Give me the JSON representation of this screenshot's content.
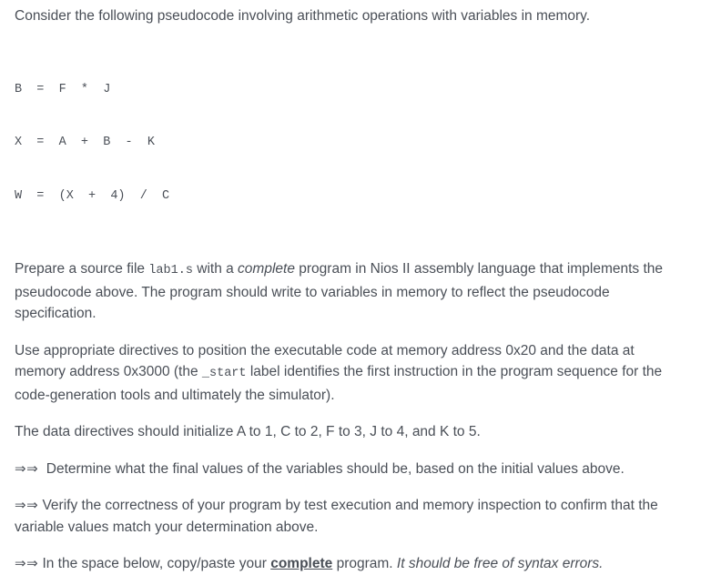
{
  "document": {
    "background_color": "#ffffff",
    "text_color": "#4a4f57",
    "intro": {
      "text": "Consider the following pseudocode involving arithmetic operations with variables in memory."
    },
    "pseudocode": {
      "lines": [
        "B  =  F  *  J",
        "X  =  A  +  B  -  K",
        "W  =  (X  +  4)  /  C"
      ],
      "line1": "B  =  F  *  J",
      "line2": "X  =  A  +  B  -  K",
      "line3": "W  =  (X  +  4)  /  C"
    },
    "prepare_paragraph": {
      "part1": "Prepare a source file ",
      "code_filename": "lab1.s",
      "part2": " with a ",
      "emphasis": "complete",
      "part3": " program in Nios II assembly language that implements the pseudocode above. The program should write to variables in memory to reflect the pseudocode specification."
    },
    "directives_paragraph": {
      "part1": "Use appropriate directives to position the executable code at memory address 0x20 and the data at memory address 0x3000 (the ",
      "code_label": "_start",
      "part2": " label identifies the first instruction in the program sequence for the code-generation tools and ultimately the simulator)."
    },
    "init_paragraph": {
      "text": "The data directives should initialize A to 1,   C to 2,   F to 3,   J to 4,   and  K to 5."
    },
    "bullets": [
      {
        "marker": "⇒⇒",
        "spacer": "  ",
        "text": "Determine what the final values of the variables should be, based on the initial values above."
      },
      {
        "marker": "⇒⇒",
        "spacer": " ",
        "text": "Verify the correctness of your program by test execution and memory inspection to confirm that the variable values match your determination above."
      }
    ],
    "final_bullet": {
      "marker": "⇒⇒",
      "spacer": " ",
      "part1": "In the space below, copy/paste your ",
      "emphasis_bold": "complete",
      "part2": " program. ",
      "emphasis_italic": "It should be free of syntax errors."
    }
  }
}
